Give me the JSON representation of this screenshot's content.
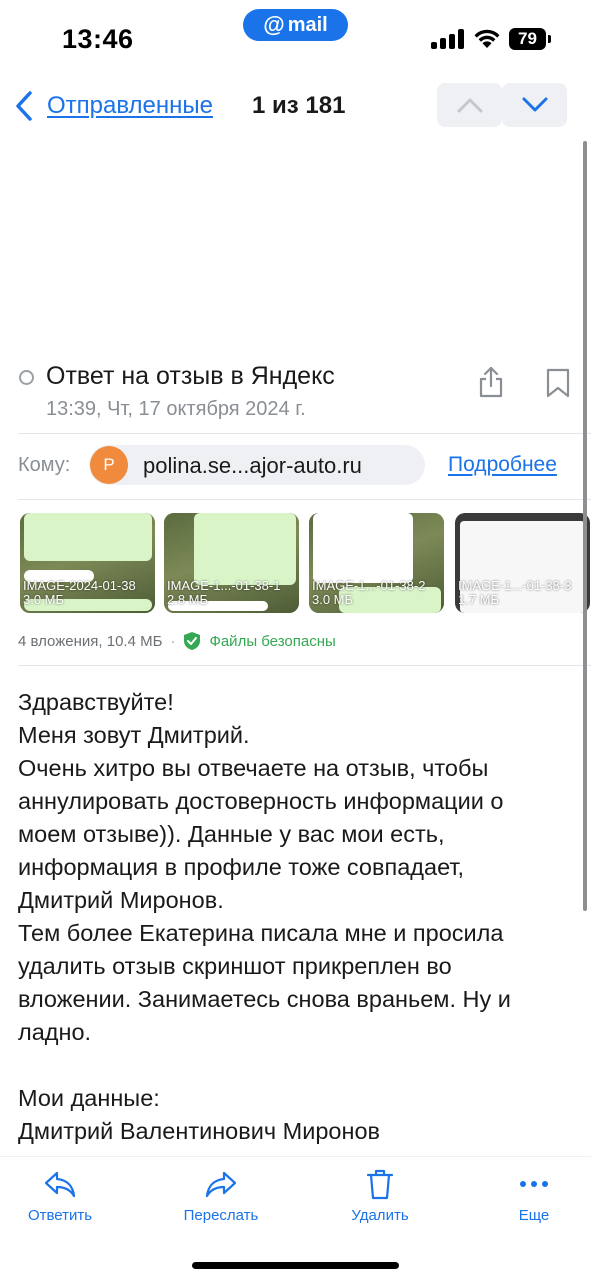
{
  "status_bar": {
    "time": "13:46",
    "app_badge": "mail",
    "battery": "79"
  },
  "nav": {
    "back_label": "Отправленные",
    "counter": "1 из 181"
  },
  "message": {
    "subject": "Ответ на отзыв в Яндекс",
    "date": "13:39, Чт, 17 октября 2024 г.",
    "to_label": "Кому:",
    "recipient_initial": "P",
    "recipient": "polina.se...ajor-auto.ru",
    "details_link": "Подробнее"
  },
  "attachments": {
    "items": [
      {
        "caption_line1": "IMAGE-2024-01-38",
        "caption_line2": "3.0 МБ"
      },
      {
        "caption_line1": "IMAGE-1...-01-38-1",
        "caption_line2": "2.8 МБ"
      },
      {
        "caption_line1": "IMAGE-1...-01-38-2",
        "caption_line2": "3.0 МБ"
      },
      {
        "caption_line1": "IMAGE-1...-01-38-3",
        "caption_line2": "1.7 МБ"
      }
    ],
    "summary": "4 вложения, 10.4 МБ",
    "separator": "·",
    "safe_label": "Файлы безопасны"
  },
  "body": {
    "lines": [
      "Здравствуйте!",
      "Меня зовут Дмитрий.",
      "Очень хитро вы отвечаете на отзыв, чтобы",
      "аннулировать достоверность информации о",
      "моем отзыве)). Данные у вас мои есть,",
      "информация в профиле тоже совпадает,",
      "Дмитрий Миронов.",
      "Тем более Екатерина писала мне и просила",
      "удалить отзыв скриншот прикреплен во",
      "вложении. Занимаетесь снова враньем. Ну и",
      "ладно.",
      "",
      "Мои данные:",
      "Дмитрий Валентинович Миронов"
    ]
  },
  "toolbar": {
    "reply": "Ответить",
    "forward": "Переслать",
    "delete": "Удалить",
    "more": "Еще"
  },
  "colors": {
    "accent": "#1a73e8",
    "safe": "#34a853",
    "avatar": "#f08a3c"
  },
  "icons": {
    "back": "chevron-left-icon",
    "up": "chevron-up-icon",
    "down": "chevron-down-icon",
    "share": "share-icon",
    "bookmark": "bookmark-icon",
    "shield": "shield-check-icon",
    "reply": "reply-icon",
    "forward": "forward-icon",
    "delete": "trash-icon",
    "more": "more-dots-icon"
  }
}
